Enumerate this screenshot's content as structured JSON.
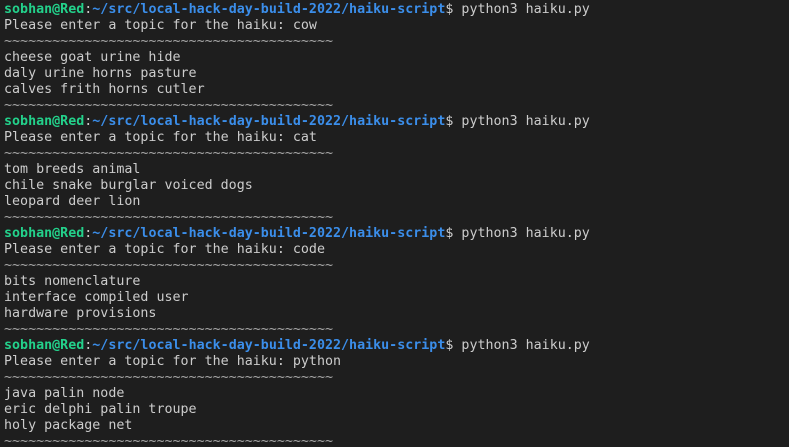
{
  "prompt": {
    "user_host": "sobhan@Red",
    "colon": ":",
    "path": "~/src/local-hack-day-build-2022/haiku-script",
    "dollar": "$ ",
    "command": "python3 haiku.py"
  },
  "separator": "~~~~~~~~~~~~~~~~~~~~~~~~~~~~~~~~~~~~~~~~~",
  "runs": [
    {
      "question": "Please enter a topic for the haiku: cow",
      "lines": [
        "cheese goat urine hide",
        "daly urine horns pasture",
        "calves frith horns cutler"
      ]
    },
    {
      "question": "Please enter a topic for the haiku: cat",
      "lines": [
        "tom breeds animal",
        "chile snake burglar voiced dogs",
        "leopard deer lion"
      ]
    },
    {
      "question": "Please enter a topic for the haiku: code",
      "lines": [
        "bits nomenclature",
        "interface compiled user",
        "hardware provisions"
      ]
    },
    {
      "question": "Please enter a topic for the haiku: python",
      "lines": [
        "java palin node",
        "eric delphi palin troupe",
        "holy package net"
      ]
    }
  ],
  "colors": {
    "background": "#1e1e1e",
    "text": "#cccccc",
    "user_host": "#23d18b",
    "path": "#3b8eea"
  }
}
